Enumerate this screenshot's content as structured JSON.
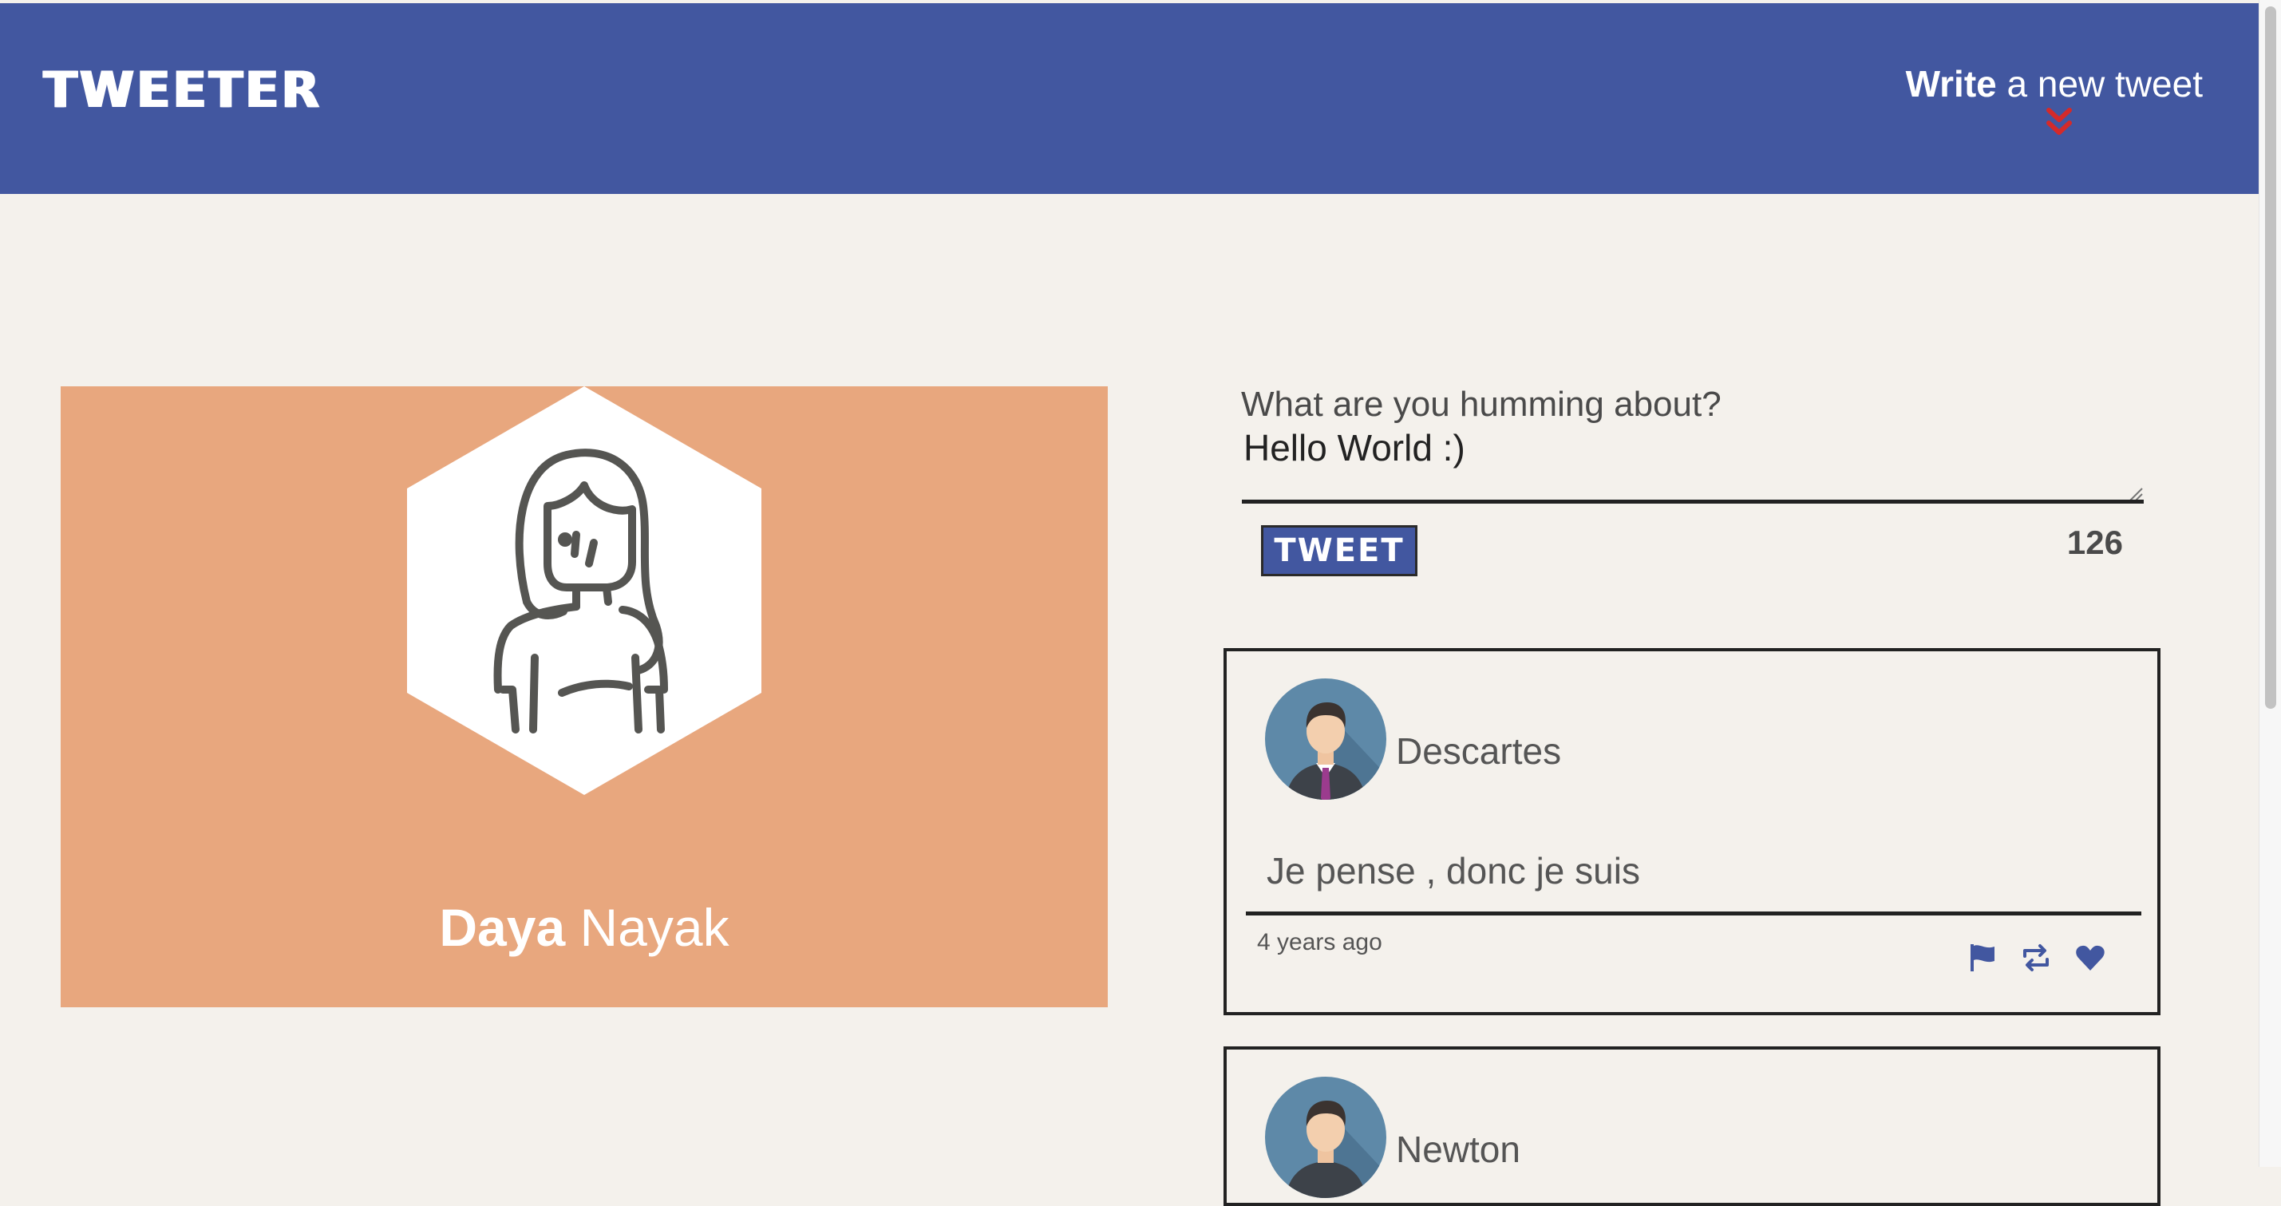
{
  "header": {
    "brand": "TWEETER",
    "compose_toggle": {
      "strong": "Write",
      "rest": " a new tweet"
    },
    "chevron_icon": "double-chevron-down-icon",
    "bg_color": "#4257a0",
    "chevron_color": "#d42a2a"
  },
  "profile": {
    "first_name": "Daya",
    "last_name": " Nayak",
    "card_color": "#e8a77e",
    "avatar_icon": "user-avatar-woman-icon"
  },
  "composer": {
    "label": "What are you humming about?",
    "value": "Hello World :)",
    "button_label": "TWEET",
    "char_count": "126"
  },
  "tweets": [
    {
      "author": "Descartes",
      "text": "Je pense , donc je suis",
      "timestamp": "4 years ago",
      "icons": [
        "flag-icon",
        "retweet-icon",
        "heart-icon"
      ]
    },
    {
      "author": "Newton"
    }
  ],
  "colors": {
    "page_bg": "#f4f1ec",
    "icon_accent": "#4257a0"
  }
}
